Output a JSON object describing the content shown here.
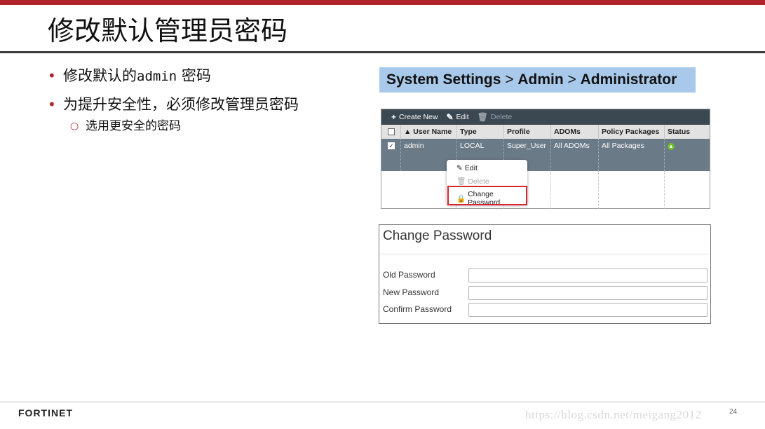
{
  "slide": {
    "title": "修改默认管理员密码",
    "bullets": {
      "b1_prefix": "修改默认的",
      "b1_code": "admin",
      "b1_suffix": " 密码",
      "b2": "为提升安全性，必须修改管理员密码",
      "b2_sub": "选用更安全的密码"
    },
    "breadcrumb": {
      "part1": "System Settings",
      "sep1": " > ",
      "part2": "Admin",
      "sep2": " > ",
      "part3": "Administrator"
    },
    "page_number": "24",
    "watermark": "https://blog.csdn.net/meigang2012"
  },
  "logo": {
    "text": "FORTINET",
    "color": "#d6262e"
  },
  "admin_panel": {
    "toolbar": {
      "create_new": "Create New",
      "edit": "Edit",
      "delete": "Delete"
    },
    "columns": [
      "▲ User Name",
      "Type",
      "Profile",
      "ADOMs",
      "Policy Packages",
      "Status"
    ],
    "row": {
      "user_name": "admin",
      "type": "LOCAL",
      "profile": "Super_User",
      "adoms": "All ADOMs",
      "policy_packages": "All Packages",
      "checked": true,
      "status_color": "#6cbf2c"
    },
    "context_menu": {
      "edit": "Edit",
      "delete": "Delete",
      "change_password": "Change Password"
    }
  },
  "change_password": {
    "title": "Change Password",
    "fields": {
      "old": "Old Password",
      "new": "New Password",
      "confirm": "Confirm Password"
    }
  },
  "colors": {
    "accent_red": "#b0232a",
    "breadcrumb_bg": "#a9c9ea",
    "toolbar_bg": "#3b4751",
    "selected_row": "#6b7a87",
    "highlight_box": "#d6262e"
  },
  "icons": [
    "plus-icon",
    "edit-icon",
    "trash-icon",
    "checkbox-icon",
    "status-up-icon",
    "lock-icon"
  ]
}
